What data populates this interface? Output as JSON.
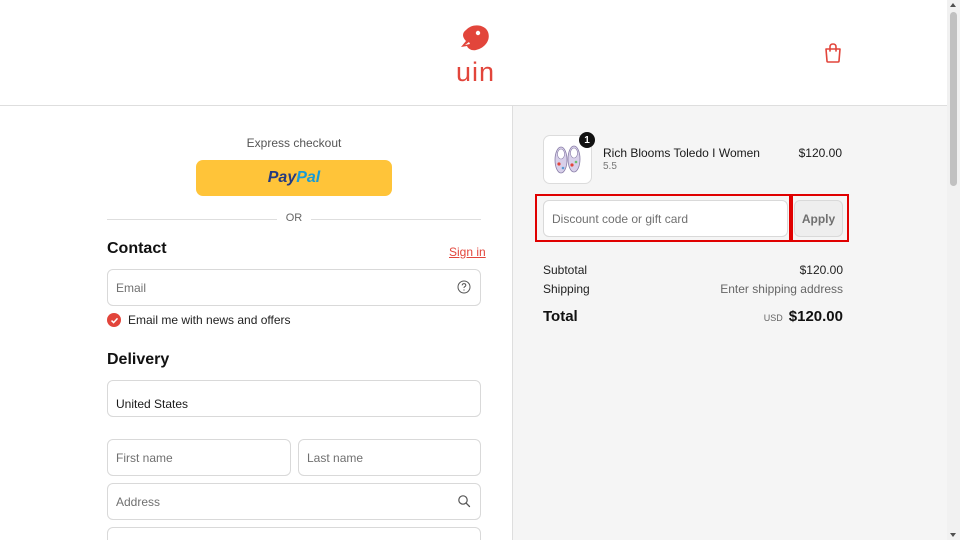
{
  "header": {
    "logo_text": "uin",
    "cart_icon": "shopping-bag-icon",
    "brand_color": "#e2453b"
  },
  "checkout": {
    "express_label": "Express checkout",
    "paypal": {
      "part1": "Pay",
      "part2": "Pal"
    },
    "or_label": "OR",
    "contact": {
      "title": "Contact",
      "signin_label": "Sign in",
      "email_placeholder": "Email",
      "help_icon": "question-circle-icon",
      "newsletter_label": "Email me with news and offers",
      "newsletter_checked": true
    },
    "delivery": {
      "title": "Delivery",
      "country": "United States",
      "first_name_placeholder": "First name",
      "last_name_placeholder": "Last name",
      "address_placeholder": "Address",
      "address_icon": "search-icon"
    }
  },
  "summary": {
    "product": {
      "name": "Rich Blooms Toledo I Women",
      "variant": "5.5",
      "price": "$120.00",
      "quantity": "1"
    },
    "discount_placeholder": "Discount code or gift card",
    "apply_label": "Apply",
    "subtotal_label": "Subtotal",
    "subtotal_value": "$120.00",
    "shipping_label": "Shipping",
    "shipping_value": "Enter shipping address",
    "total_label": "Total",
    "currency": "USD",
    "total_value": "$120.00"
  },
  "highlight_color": "#e00000"
}
